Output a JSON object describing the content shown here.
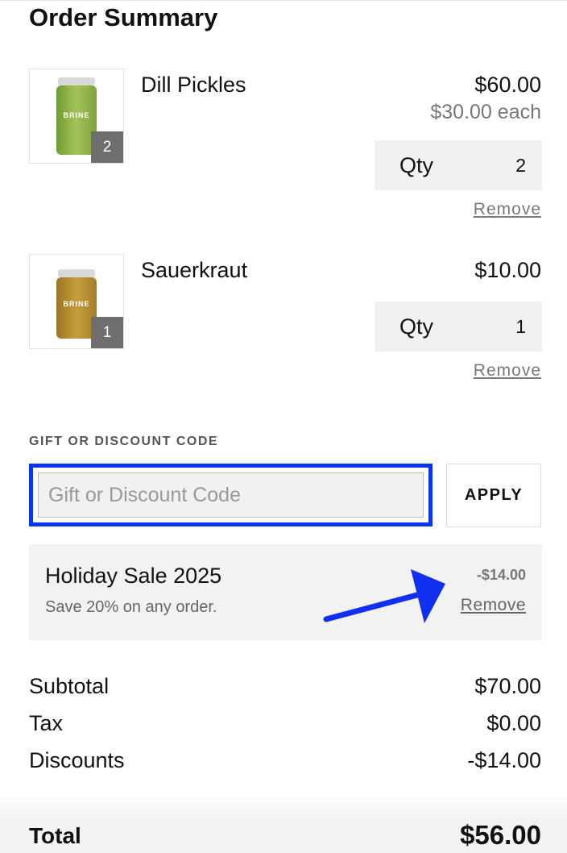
{
  "header": {
    "title": "Order Summary"
  },
  "items": [
    {
      "name": "Dill Pickles",
      "price": "$60.00",
      "unit_price": "$30.00 each",
      "qty_label": "Qty",
      "qty": "2",
      "badge": "2",
      "jar_label": "BRINE",
      "remove_label": "Remove",
      "jar_color": "#8fb04a"
    },
    {
      "name": "Sauerkraut",
      "price": "$10.00",
      "qty_label": "Qty",
      "qty": "1",
      "badge": "1",
      "jar_label": "BRINE",
      "remove_label": "Remove",
      "jar_color": "#b8902e"
    }
  ],
  "discount": {
    "heading": "GIFT OR DISCOUNT CODE",
    "placeholder": "Gift or Discount Code",
    "value": "",
    "apply_label": "APPLY"
  },
  "promo": {
    "name": "Holiday Sale 2025",
    "description": "Save 20% on any order.",
    "amount": "-$14.00",
    "remove_label": "Remove"
  },
  "summary": {
    "subtotal_label": "Subtotal",
    "subtotal": "$70.00",
    "tax_label": "Tax",
    "tax": "$0.00",
    "discounts_label": "Discounts",
    "discounts": "-$14.00",
    "total_label": "Total",
    "total": "$56.00"
  },
  "colors": {
    "highlight": "#0a35f0",
    "arrow": "#1030f0",
    "promo_bg": "#f2f2f2",
    "qty_bg": "#f1f1f1"
  }
}
